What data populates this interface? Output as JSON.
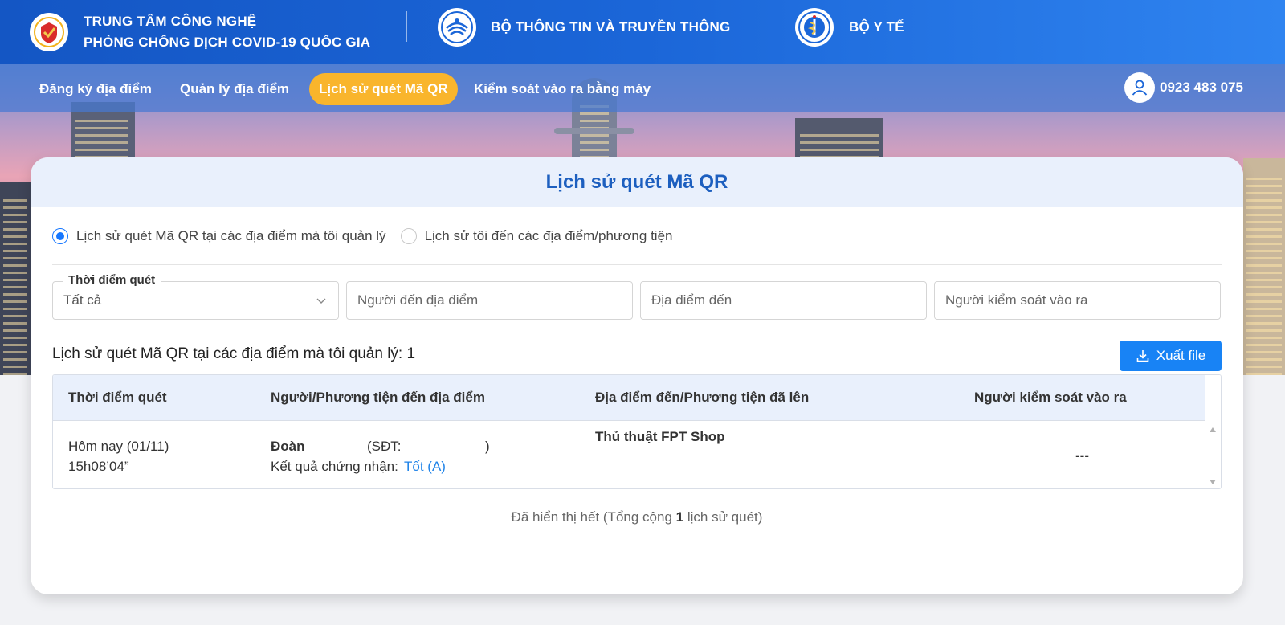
{
  "header": {
    "org1": {
      "line1": "TRUNG TÂM CÔNG NGHỆ",
      "line2": "PHÒNG CHỐNG DỊCH COVID-19 QUỐC GIA"
    },
    "org2": {
      "name": "BỘ THÔNG TIN VÀ TRUYỀN THÔNG"
    },
    "org3": {
      "name": "BỘ Y TẾ"
    }
  },
  "nav": {
    "items": [
      {
        "label": "Đăng ký địa điểm"
      },
      {
        "label": "Quản lý địa điểm"
      },
      {
        "label": "Lịch sử quét Mã QR",
        "active": true
      },
      {
        "label": "Kiểm soát vào ra bằng máy"
      }
    ],
    "user_phone": "0923 483 075"
  },
  "card": {
    "title": "Lịch sử quét Mã QR",
    "radios": [
      {
        "label": "Lịch sử quét Mã QR tại các địa điểm mà tôi quản lý",
        "checked": true
      },
      {
        "label": "Lịch sử tôi đến các địa điểm/phương tiện",
        "checked": false
      }
    ],
    "filters": {
      "time": {
        "label": "Thời điểm quét",
        "value": "Tất cả"
      },
      "person": {
        "placeholder": "Người đến địa điểm"
      },
      "place": {
        "placeholder": "Địa điểm đến"
      },
      "controller": {
        "placeholder": "Người kiểm soát vào ra"
      }
    },
    "summary": "Lịch sử quét Mã QR tại các địa điểm mà tôi quản lý: 1",
    "export_label": "Xuất file",
    "table": {
      "columns": [
        "Thời điểm quét",
        "Người/Phương tiện đến địa điểm",
        "Địa điểm đến/Phương tiện đã lên",
        "Người kiểm soát vào ra"
      ],
      "rows": [
        {
          "date": "Hôm nay (01/11)",
          "time": "15h08’04”",
          "person_name": "Đoàn",
          "phone_label": "(SĐT:",
          "phone_close": ")",
          "cert_label": "Kết quả chứng nhận:",
          "cert_value": "Tốt (A)",
          "place": "Thủ thuật FPT Shop",
          "controller": "---"
        }
      ]
    },
    "footer": {
      "prefix": "Đã hiển thị hết (Tổng cộng",
      "count": "1",
      "suffix": "lịch sử quét)"
    }
  },
  "colors": {
    "header_blue": "#1b66d8",
    "active_tab": "#f9b52c",
    "accent": "#1883f5",
    "title_blue": "#1d5fbf"
  },
  "icons": [
    "covid-center-logo",
    "ministry-ic-logo",
    "ministry-health-logo",
    "user-icon",
    "chevron-down-icon",
    "download-icon"
  ]
}
